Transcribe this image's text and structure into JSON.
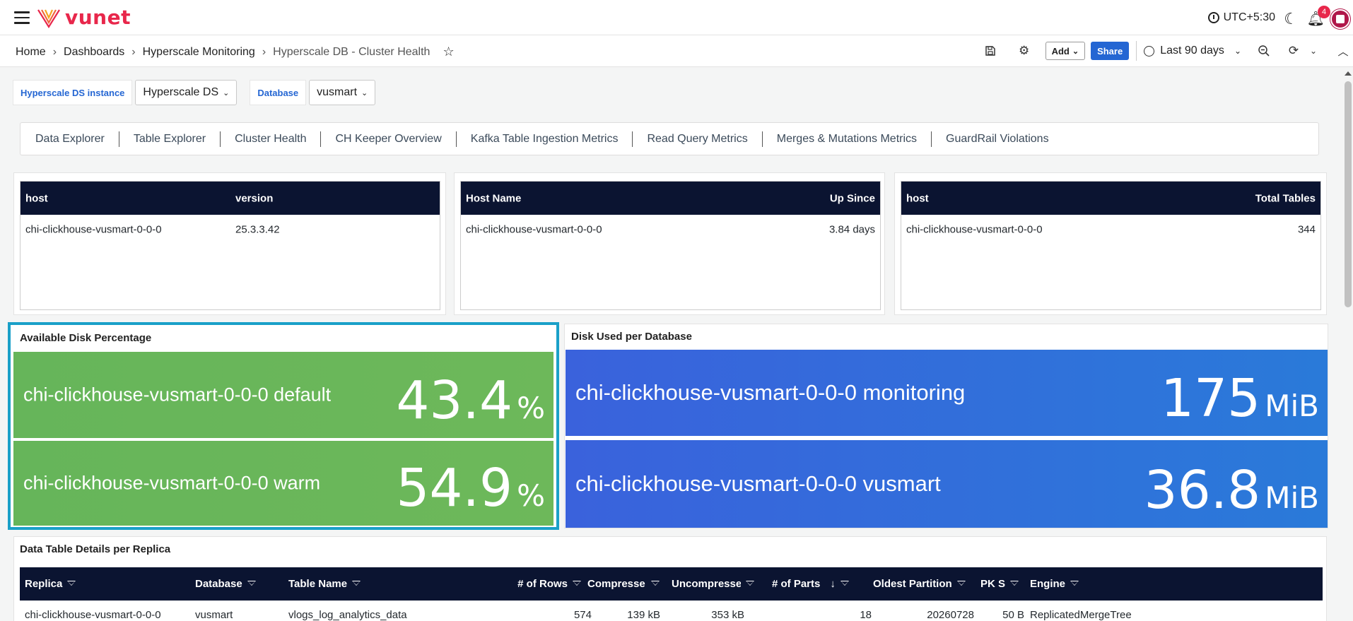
{
  "app": {
    "logo_text": "vunet"
  },
  "topbar": {
    "timezone": "UTC+5:30",
    "notifications_count": "4"
  },
  "breadcrumb": {
    "items": [
      "Home",
      "Dashboards",
      "Hyperscale Monitoring"
    ],
    "current": "Hyperscale DB - Cluster Health"
  },
  "actions": {
    "add_label": "Add",
    "share_label": "Share",
    "time_range": "Last 90 days"
  },
  "variables": [
    {
      "label": "Hyperscale DS instance",
      "value": "Hyperscale DS"
    },
    {
      "label": "Database",
      "value": "vusmart"
    }
  ],
  "tabs": [
    "Data Explorer",
    "Table Explorer",
    "Cluster Health",
    "CH Keeper Overview",
    "Kafka Table Ingestion Metrics",
    "Read Query Metrics",
    "Merges & Mutations Metrics",
    "GuardRail Violations"
  ],
  "version_table": {
    "headers": [
      "host",
      "version"
    ],
    "rows": [
      [
        "chi-clickhouse-vusmart-0-0-0",
        "25.3.3.42"
      ]
    ]
  },
  "uptime_table": {
    "headers": [
      "Host Name",
      "Up Since"
    ],
    "rows": [
      [
        "chi-clickhouse-vusmart-0-0-0",
        "3.84 days"
      ]
    ]
  },
  "tables_table": {
    "headers": [
      "host",
      "Total Tables"
    ],
    "rows": [
      [
        "chi-clickhouse-vusmart-0-0-0",
        "344"
      ]
    ]
  },
  "disk_available": {
    "title": "Available Disk Percentage",
    "items": [
      {
        "name": "chi-clickhouse-vusmart-0-0-0 default",
        "value": "43.4",
        "unit": "%"
      },
      {
        "name": "chi-clickhouse-vusmart-0-0-0 warm",
        "value": "54.9",
        "unit": "%"
      }
    ]
  },
  "disk_used": {
    "title": "Disk Used per Database",
    "items": [
      {
        "name": "chi-clickhouse-vusmart-0-0-0 monitoring",
        "value": "175",
        "unit": "MiB"
      },
      {
        "name": "chi-clickhouse-vusmart-0-0-0 vusmart",
        "value": "36.8",
        "unit": "MiB"
      }
    ]
  },
  "details_table": {
    "title": "Data Table Details per Replica",
    "headers": [
      "Replica",
      "Database",
      "Table Name",
      "# of Rows",
      "Compresse",
      "Uncompresse",
      "# of Parts",
      "Oldest Partition",
      "PK S",
      "Engine"
    ],
    "sort_indicator": "↓",
    "rows": [
      [
        "chi-clickhouse-vusmart-0-0-0",
        "vusmart",
        "vlogs_log_analytics_data",
        "574",
        "139 kB",
        "353 kB",
        "18",
        "20260728",
        "50 B",
        "ReplicatedMergeTree"
      ]
    ]
  },
  "colors": {
    "accent": "#2466d3",
    "brand": "#e8274b",
    "stat_green": "#6db85a",
    "stat_blue": "#2f6fdb",
    "table_header": "#0b1431",
    "selection_border": "#1aa0c8"
  }
}
